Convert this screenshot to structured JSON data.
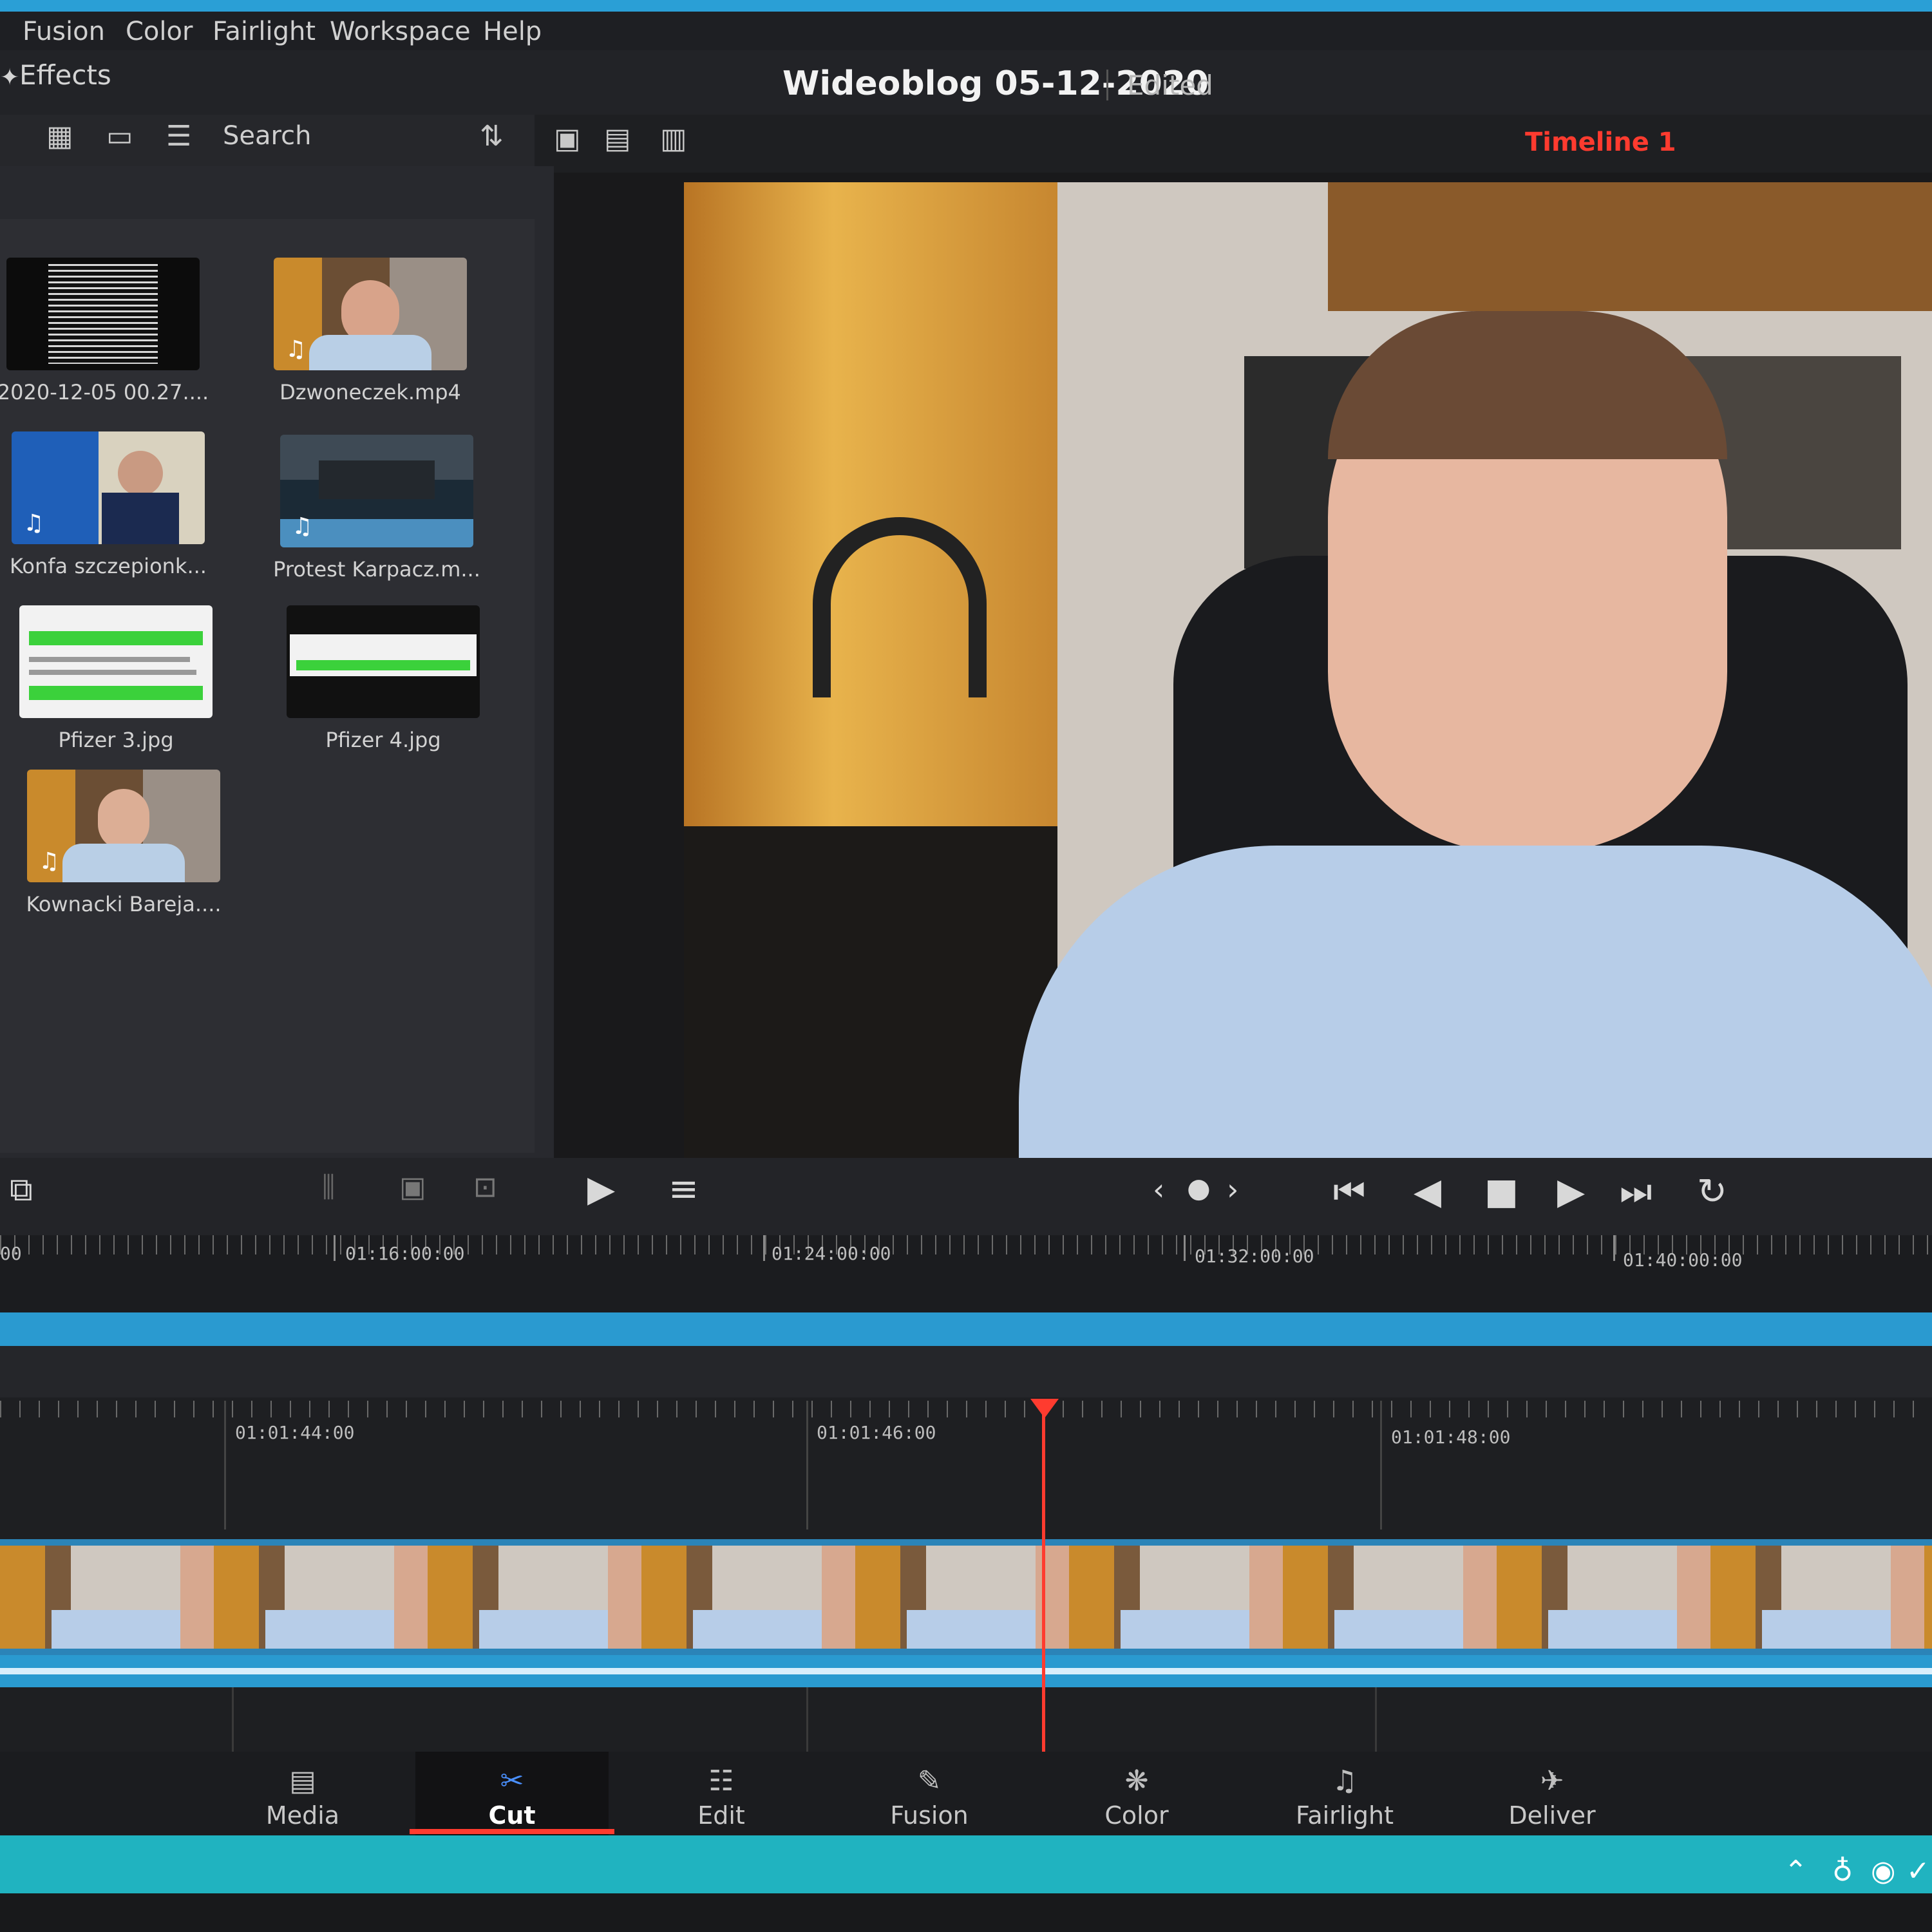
{
  "menu": [
    "Fusion",
    "Color",
    "Fairlight",
    "Workspace",
    "Help"
  ],
  "effects_label": "Effects",
  "project": {
    "title": "Wideoblog 05-12-2020",
    "status": "Edited"
  },
  "media_toolbar": {
    "search_label": "Search"
  },
  "timeline_name": "Timeline 1",
  "clips": [
    {
      "label": "2020-12-05 00.27...."
    },
    {
      "label": "Dzwoneczek.mp4"
    },
    {
      "label": "Konfa szczepionk..."
    },
    {
      "label": "Protest Karpacz.m..."
    },
    {
      "label": "Pfizer 3.jpg"
    },
    {
      "label": "Pfizer 4.jpg"
    },
    {
      "label": "Kownacki Bareja...."
    }
  ],
  "ruler_top": [
    "00",
    "01:16:00:00",
    "01:24:00:00",
    "01:32:00:00",
    "01:40:00:00"
  ],
  "ruler_bottom": [
    "01:01:44:00",
    "01:01:46:00",
    "01:01:48:00"
  ],
  "pages": [
    {
      "label": "Media",
      "icon": "media-icon"
    },
    {
      "label": "Cut",
      "icon": "cut-icon"
    },
    {
      "label": "Edit",
      "icon": "edit-icon"
    },
    {
      "label": "Fusion",
      "icon": "fusion-icon"
    },
    {
      "label": "Color",
      "icon": "color-icon"
    },
    {
      "label": "Fairlight",
      "icon": "fairlight-icon"
    },
    {
      "label": "Deliver",
      "icon": "deliver-icon"
    }
  ],
  "colors": {
    "accent_red": "#ff3b2f",
    "track_blue": "#2a9ad0"
  }
}
